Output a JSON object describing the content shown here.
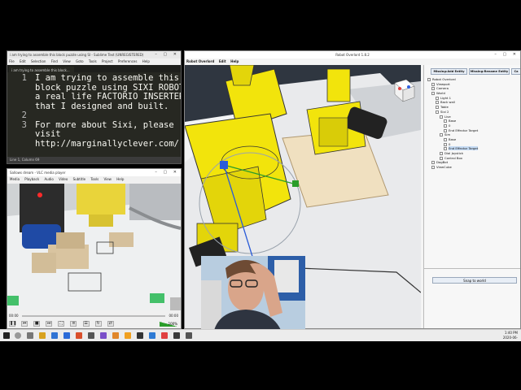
{
  "sublime": {
    "title": "i am trying to assemble this block puzzle using SI - Sublime Text (UNREGISTERED)",
    "menu": [
      "File",
      "Edit",
      "Selection",
      "Find",
      "View",
      "Goto",
      "Tools",
      "Project",
      "Preferences",
      "Help"
    ],
    "tab": "i am trying to assemble this block...",
    "lines": [
      {
        "num": "1",
        "text": "I am trying to assemble this"
      },
      {
        "num": "",
        "text": "block puzzle using SIXI ROBOT,"
      },
      {
        "num": "",
        "text": "a real life FACTORIO INSERTER"
      },
      {
        "num": "",
        "text": "that I designed and built."
      },
      {
        "num": "2",
        "text": ""
      },
      {
        "num": "3",
        "text": "For more about Sixi, please"
      },
      {
        "num": "",
        "text": "visit"
      },
      {
        "num": "",
        "text": "http://marginallyclever.com/"
      }
    ],
    "status": "Line 1, Column 69"
  },
  "vlc": {
    "title": "Sallows dream - VLC media player",
    "menu": [
      "Media",
      "Playback",
      "Audio",
      "Video",
      "Subtitle",
      "Tools",
      "View",
      "Help"
    ],
    "time_left": "00:00",
    "time_right": "00:00",
    "volume": "100%"
  },
  "robot": {
    "title": "Robot Overlord 1.8.2",
    "menu": [
      "Robot Overlord",
      "Edit",
      "Help"
    ],
    "buttons": {
      "add": "Missing:Add Entity",
      "rename": "Missing:Rename Entity",
      "extra": "Ca"
    },
    "tree": [
      {
        "label": "Robot Overlord",
        "indent": 0
      },
      {
        "label": "Viewport",
        "indent": 1
      },
      {
        "label": "Camera",
        "indent": 1
      },
      {
        "label": "World",
        "indent": 1
      },
      {
        "label": "Light 1",
        "indent": 2
      },
      {
        "label": "Back wall",
        "indent": 2
      },
      {
        "label": "Table",
        "indent": 2
      },
      {
        "label": "Sixi 2",
        "indent": 2
      },
      {
        "label": "Live",
        "indent": 3
      },
      {
        "label": "Base",
        "indent": 4
      },
      {
        "label": "0",
        "indent": 4
      },
      {
        "label": "End Effector Target",
        "indent": 4
      },
      {
        "label": "Sim",
        "indent": 3
      },
      {
        "label": "Base",
        "indent": 4
      },
      {
        "label": "0",
        "indent": 4
      },
      {
        "label": "End Effector Target",
        "indent": 4,
        "selected": true
      },
      {
        "label": "Dial Joystick",
        "indent": 3
      },
      {
        "label": "Control Box",
        "indent": 3
      },
      {
        "label": "DogBot",
        "indent": 1
      },
      {
        "label": "ViewCube",
        "indent": 1
      }
    ],
    "snap_label": "Snap to world"
  },
  "taskbar": {
    "time": "1:40 PM",
    "date": "2020-06-"
  },
  "colors": {
    "robot_yellow": "#f2e40c",
    "editor_bg": "#272822",
    "accent_blue": "#2a5bd7"
  }
}
